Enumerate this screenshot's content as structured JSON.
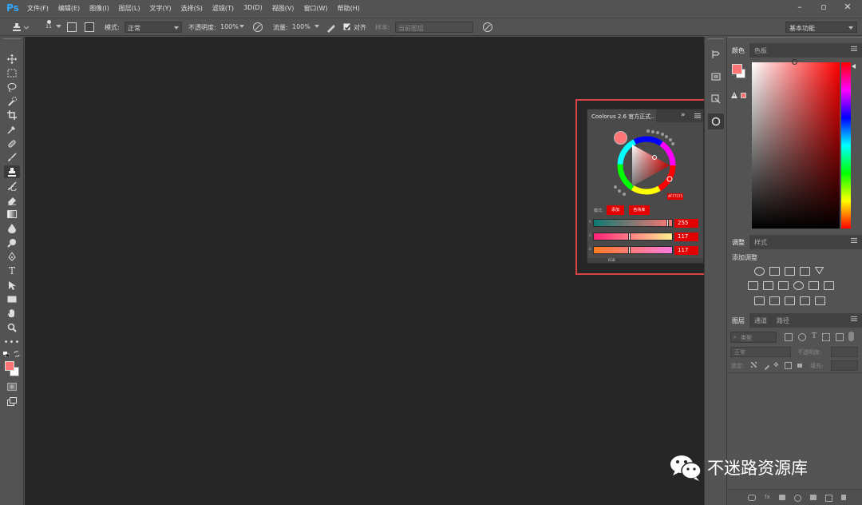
{
  "app": {
    "logo": "Ps"
  },
  "menu": [
    "文件(F)",
    "编辑(E)",
    "图像(I)",
    "图层(L)",
    "文字(Y)",
    "选择(S)",
    "滤镜(T)",
    "3D(D)",
    "视图(V)",
    "窗口(W)",
    "帮助(H)"
  ],
  "options": {
    "brush_size": "11",
    "mode_label": "模式:",
    "mode_value": "正常",
    "opacity_label": "不透明度:",
    "opacity_value": "100%",
    "flow_label": "流量:",
    "flow_value": "100%",
    "align_label": "对齐",
    "sample_label": "样本:",
    "sample_value": "当前图层",
    "workspace": "基本功能"
  },
  "coolorus": {
    "title": "Coolorus 2.6 官方正式..",
    "collapse": "»",
    "mode_label": "模式:",
    "btn1": "添加",
    "btn2": "色块库",
    "hex_tag": "#FF7575",
    "sliders": [
      {
        "label": "R",
        "value": "255",
        "marker": 0.97
      },
      {
        "label": "G",
        "value": "117",
        "marker": 0.46
      },
      {
        "label": "B",
        "value": "117",
        "marker": 0.46
      }
    ],
    "footer": "RGB"
  },
  "panels": {
    "color": {
      "tabs": [
        "颜色",
        "色板"
      ]
    },
    "adjust": {
      "tabs": [
        "调整",
        "样式"
      ],
      "add_label": "添加调整"
    },
    "layers": {
      "tabs": [
        "图层",
        "通道",
        "路径"
      ],
      "kind": "类型",
      "blend": "正常",
      "opacity_label": "不透明度:",
      "lock_label": "锁定:",
      "fill_label": "填充:"
    }
  },
  "colors": {
    "foreground": "#FF7575",
    "accent_red": "#e30000",
    "highlight_box": "#d64545"
  },
  "watermark": {
    "text": "不迷路资源库"
  }
}
